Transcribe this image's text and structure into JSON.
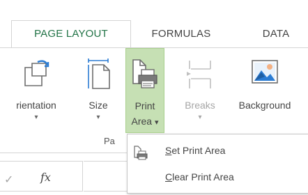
{
  "tabs": [
    {
      "label": "PAGE LAYOUT",
      "active": true
    },
    {
      "label": "FORMULAS",
      "active": false
    },
    {
      "label": "DATA",
      "active": false
    }
  ],
  "ribbon": {
    "buttons": {
      "orientation": {
        "label": "Orientation",
        "display_label": "rientation",
        "arrow": "▾"
      },
      "size": {
        "label": "Size",
        "arrow": "▾"
      },
      "print_area": {
        "label_line1": "Print",
        "label_line2": "Area",
        "arrow": "▾"
      },
      "breaks": {
        "label": "Breaks",
        "arrow": "▾"
      },
      "background": {
        "label": "Background"
      }
    },
    "group_label": "Pa"
  },
  "formula_bar": {
    "cancel_symbol": "✓",
    "fx_label": "fx"
  },
  "print_area_menu": {
    "items": [
      {
        "first": "S",
        "rest": "et Print Area"
      },
      {
        "first": "C",
        "rest": "lear Print Area"
      }
    ]
  },
  "colors": {
    "accent": "#217346",
    "pressed_bg": "#c6e0b4",
    "pressed_border": "#a9d08e",
    "border": "#d4d4d4"
  }
}
